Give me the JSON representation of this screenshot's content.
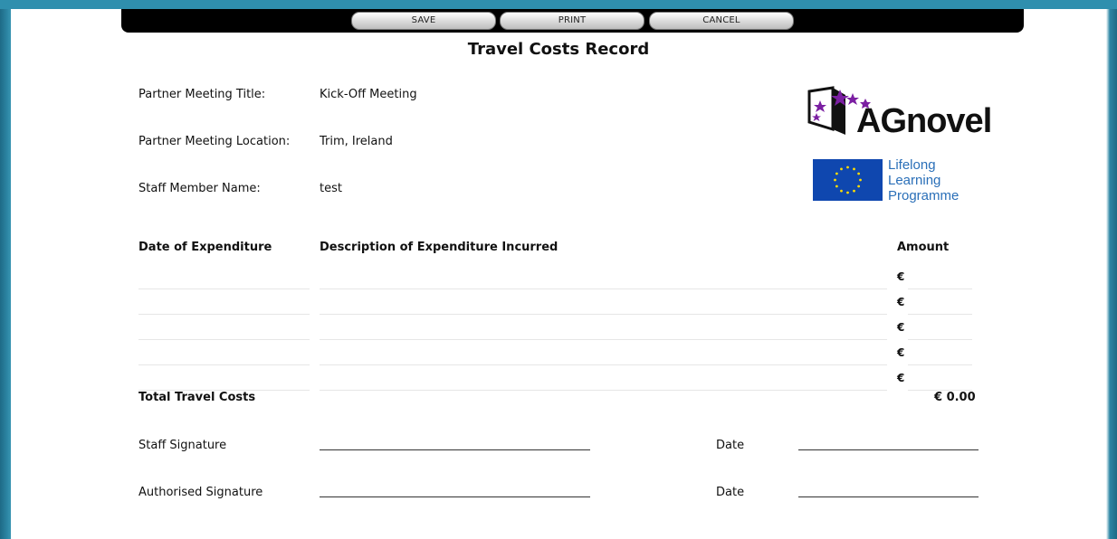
{
  "toolbar": {
    "save": "SAVE",
    "print": "PRINT",
    "cancel": "CANCEL"
  },
  "title": "Travel Costs Record",
  "meeting": {
    "title_label": "Partner Meeting Title:",
    "title_value": "Kick-Off Meeting",
    "location_label": "Partner Meeting Location:",
    "location_value": "Trim, Ireland",
    "staff_label": "Staff Member Name:",
    "staff_value": "test"
  },
  "logos": {
    "agnovel": "AGnovel",
    "lll_lines": [
      "Lifelong",
      "Learning",
      "Programme"
    ],
    "colors": {
      "star_purple": "#7b1fa2",
      "eu_blue": "#0f47af",
      "eu_yellow": "#ffdd00",
      "lll_text": "#2a6fb8"
    }
  },
  "table": {
    "headers": {
      "date": "Date of Expenditure",
      "description": "Description of Expenditure Incurred",
      "amount": "Amount"
    },
    "rows": [
      {
        "currency": "€"
      },
      {
        "currency": "€"
      },
      {
        "currency": "€"
      },
      {
        "currency": "€"
      },
      {
        "currency": "€"
      }
    ],
    "total_label": "Total Travel Costs",
    "total_value": "€ 0.00"
  },
  "signatures": {
    "staff_label": "Staff Signature",
    "authorised_label": "Authorised Signature",
    "date_label": "Date"
  }
}
